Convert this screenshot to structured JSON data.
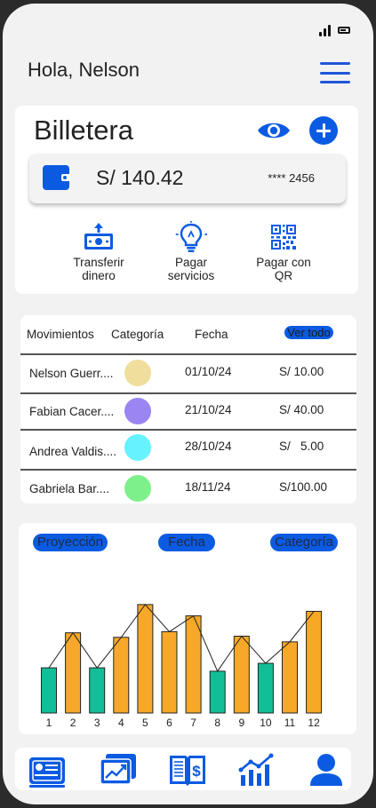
{
  "status_bar": {
    "signal_icon": "signal-icon",
    "battery_icon": "battery-icon"
  },
  "header": {
    "greeting": "Hola, Nelson",
    "menu_icon": "hamburger-menu-icon"
  },
  "wallet": {
    "title": "Billetera",
    "balance": "S/ 140.42",
    "card_number": "**** 2456",
    "eye_icon": "eye-icon",
    "add_icon": "plus-icon",
    "actions": [
      {
        "label_line1": "Transferir",
        "label_line2": "dinero",
        "icon": "transfer-money-icon"
      },
      {
        "label_line1": "Pagar",
        "label_line2": "servicios",
        "icon": "lightbulb-icon"
      },
      {
        "label_line1": "Pagar con",
        "label_line2": "QR",
        "icon": "qr-code-icon"
      }
    ]
  },
  "movements": {
    "headers": {
      "movimientos": "Movimientos",
      "categoria": "Categoría",
      "fecha": "Fecha",
      "ver_todo": "Ver todo"
    },
    "rows": [
      {
        "name": "Nelson Guerr....",
        "color": "#f0df9c",
        "date": "01/10/24",
        "amount": "S/ 10.00"
      },
      {
        "name": "Fabian Cacer....",
        "color": "#9a85f2",
        "date": "21/10/24",
        "amount": "S/ 40.00"
      },
      {
        "name": "Andrea Valdis....",
        "color": "#66f2ff",
        "date": "28/10/24",
        "amount": "S/   5.00"
      },
      {
        "name": "Gabriela Bar....",
        "color": "#7ef08a",
        "date": "18/11/24",
        "amount": "S/100.00"
      }
    ]
  },
  "chart_filters": {
    "proyeccion": "Proyección",
    "fecha": "Fecha",
    "categoria": "Categoría"
  },
  "chart_data": {
    "type": "bar",
    "categories": [
      "1",
      "2",
      "3",
      "4",
      "5",
      "6",
      "7",
      "8",
      "9",
      "10",
      "11",
      "12"
    ],
    "values": [
      40,
      71,
      40,
      67,
      96,
      72,
      86,
      37,
      68,
      44,
      63,
      90
    ],
    "bar_colors": [
      "#12be98",
      "#f7a828",
      "#12be98",
      "#f7a828",
      "#f7a828",
      "#f7a828",
      "#f7a828",
      "#12be98",
      "#f7a828",
      "#12be98",
      "#f7a828",
      "#f7a828"
    ],
    "line_overlay": true,
    "ylim": [
      0,
      100
    ],
    "title": "",
    "xlabel": "",
    "ylabel": ""
  },
  "bottom_nav": {
    "items": [
      {
        "icon": "dashboard-card-icon"
      },
      {
        "icon": "trend-chart-icon"
      },
      {
        "icon": "finance-book-icon"
      },
      {
        "icon": "bar-line-chart-icon"
      },
      {
        "icon": "user-profile-icon"
      }
    ]
  },
  "colors": {
    "primary": "#0b5be2",
    "background": "#f2f2f2",
    "bar_teal": "#12be98",
    "bar_orange": "#f7a828"
  }
}
